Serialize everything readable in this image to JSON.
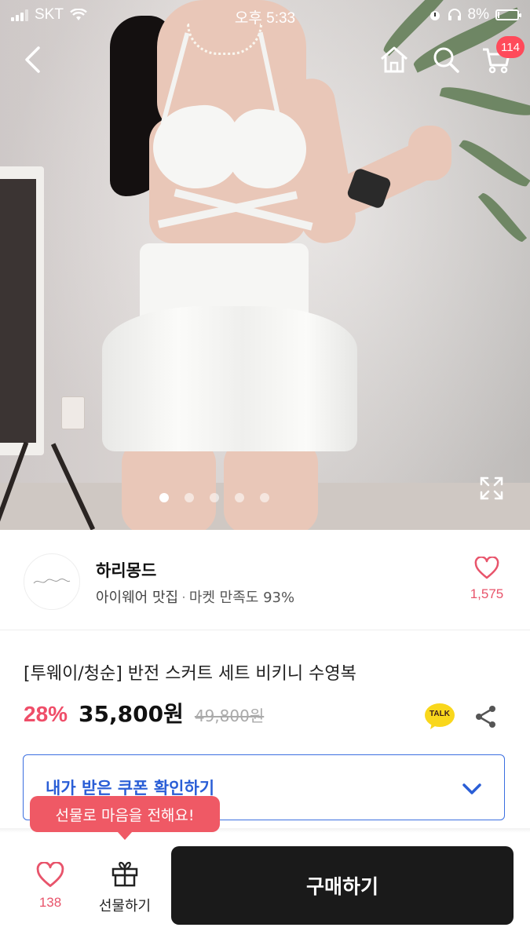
{
  "status_bar": {
    "carrier": "SKT",
    "time": "오후 5:33",
    "battery_percent": "8%",
    "battery_level": 0.08
  },
  "header": {
    "cart_badge": "114"
  },
  "gallery": {
    "image_count": 5,
    "active_index": 0
  },
  "seller": {
    "name": "하리몽드",
    "tag": "아이웨어 맛집",
    "separator": "·",
    "satisfaction": "마켓 만족도 93%",
    "like_count": "1,575"
  },
  "product": {
    "title": "[투웨이/청순] 반전 스커트 세트 비키니 수영복",
    "discount": "28%",
    "price": "35,800원",
    "original_price": "49,800원",
    "talk_label": "TALK"
  },
  "coupon": {
    "label": "내가 받은 쿠폰 확인하기"
  },
  "gift_tooltip": {
    "text": "선물로 마음을 전해요!"
  },
  "bottom_bar": {
    "like_count": "138",
    "gift_label": "선물하기",
    "buy_label": "구매하기"
  },
  "colors": {
    "accent_pink": "#ef4e69",
    "coupon_blue": "#2a5ed6",
    "buy_button": "#1a1a1a",
    "tooltip": "#ef5965"
  }
}
